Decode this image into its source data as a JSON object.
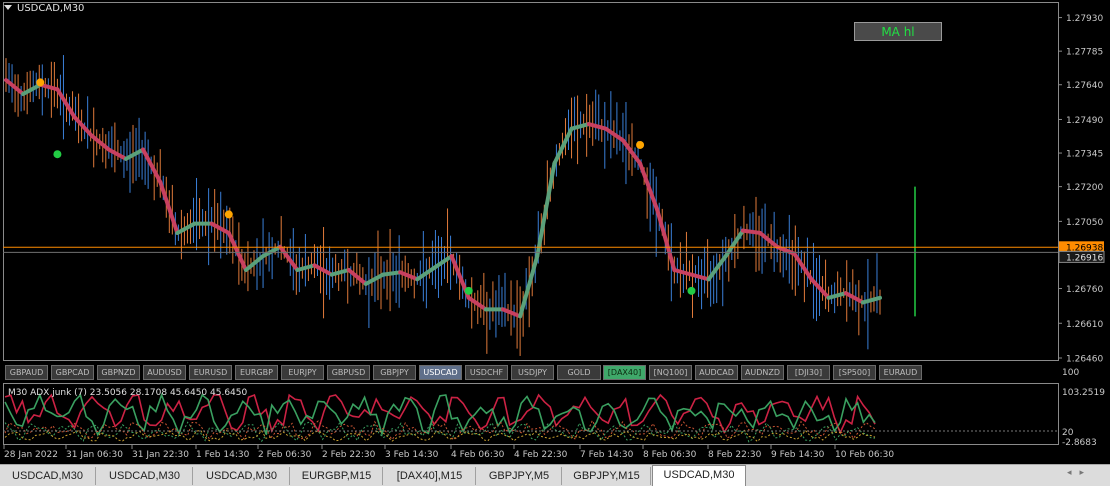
{
  "window": {
    "title": "USDCAD,M30"
  },
  "ma_button": {
    "label": "MA hl"
  },
  "price_axis": {
    "ticks": [
      "1.27930",
      "1.27785",
      "1.27640",
      "1.27490",
      "1.27345",
      "1.27200",
      "1.27050",
      "1.26760",
      "1.26610",
      "1.26460"
    ],
    "current_price_label": "1.26938",
    "bid_label": "1.26916"
  },
  "time_axis": {
    "ticks": [
      "28 Jan 2022",
      "31 Jan 06:30",
      "31 Jan 22:30",
      "1 Feb 14:30",
      "2 Feb 06:30",
      "2 Feb 22:30",
      "3 Feb 14:30",
      "4 Feb 06:30",
      "4 Feb 22:30",
      "7 Feb 14:30",
      "8 Feb 06:30",
      "8 Feb 22:30",
      "9 Feb 14:30",
      "10 Feb 06:30"
    ]
  },
  "symbol_buttons": [
    {
      "label": "GBPAUD",
      "state": "normal"
    },
    {
      "label": "GBPCAD",
      "state": "normal"
    },
    {
      "label": "GBPNZD",
      "state": "normal"
    },
    {
      "label": "AUDUSD",
      "state": "normal"
    },
    {
      "label": "EURUSD",
      "state": "normal"
    },
    {
      "label": "EURGBP",
      "state": "normal"
    },
    {
      "label": "EURJPY",
      "state": "normal"
    },
    {
      "label": "GBPUSD",
      "state": "normal"
    },
    {
      "label": "GBPJPY",
      "state": "normal"
    },
    {
      "label": "USDCAD",
      "state": "active"
    },
    {
      "label": "USDCHF",
      "state": "normal"
    },
    {
      "label": "USDJPY",
      "state": "normal"
    },
    {
      "label": "GOLD",
      "state": "normal"
    },
    {
      "label": "[DAX40]",
      "state": "green"
    },
    {
      "label": "[NQ100]",
      "state": "normal"
    },
    {
      "label": "AUDCAD",
      "state": "normal"
    },
    {
      "label": "AUDNZD",
      "state": "normal"
    },
    {
      "label": "[DJI30]",
      "state": "normal"
    },
    {
      "label": "[SP500]",
      "state": "normal"
    },
    {
      "label": "EURAUD",
      "state": "normal"
    }
  ],
  "indicator": {
    "label": "M30  ADX junk (7) 23.5056 28.1708 45.6450 45.6450",
    "axis_labels": [
      "100",
      "103.2519",
      "20",
      "-2.8683"
    ]
  },
  "tabs": [
    {
      "label": "USDCAD,M30",
      "active": false
    },
    {
      "label": "USDCAD,M30",
      "active": false
    },
    {
      "label": "USDCAD,M30",
      "active": false
    },
    {
      "label": "EURGBP,M15",
      "active": false
    },
    {
      "label": "[DAX40],M15",
      "active": false
    },
    {
      "label": "GBPJPY,M5",
      "active": false
    },
    {
      "label": "GBPJPY,M15",
      "active": false
    },
    {
      "label": "USDCAD,M30",
      "active": true
    }
  ],
  "chart_data": {
    "type": "line",
    "symbol": "USDCAD",
    "timeframe": "M30",
    "ylim": [
      1.2646,
      1.2798
    ],
    "ma_line": [
      1.2766,
      1.276,
      1.2764,
      1.2762,
      1.275,
      1.2742,
      1.2736,
      1.2732,
      1.2736,
      1.2722,
      1.27,
      1.2704,
      1.2704,
      1.27,
      1.2684,
      1.269,
      1.2694,
      1.2684,
      1.2686,
      1.2682,
      1.2684,
      1.2678,
      1.2682,
      1.2683,
      1.268,
      1.2685,
      1.269,
      1.2672,
      1.2667,
      1.2667,
      1.2664,
      1.269,
      1.273,
      1.2745,
      1.2747,
      1.2745,
      1.274,
      1.273,
      1.271,
      1.2684,
      1.2682,
      1.268,
      1.269,
      1.2701,
      1.27,
      1.2694,
      1.2691,
      1.268,
      1.2672,
      1.2674,
      1.267,
      1.2672
    ],
    "dots": [
      {
        "i": 2,
        "price": 1.2765,
        "color": "#ffa500"
      },
      {
        "i": 3,
        "price": 1.2734,
        "color": "#22cc44"
      },
      {
        "i": 13,
        "price": 1.2708,
        "color": "#ffa500"
      },
      {
        "i": 27,
        "price": 1.2675,
        "color": "#22cc44"
      },
      {
        "i": 37,
        "price": 1.2738,
        "color": "#ffa500"
      },
      {
        "i": 40,
        "price": 1.2675,
        "color": "#22cc44"
      }
    ],
    "current_price": 1.26938,
    "bid_price": 1.26916,
    "colors": {
      "up": "#3a7fd8",
      "down": "#e07a3a",
      "ma_up": "#5aa07a",
      "ma_down": "#c84060",
      "price_line": "#ff8c00"
    }
  }
}
